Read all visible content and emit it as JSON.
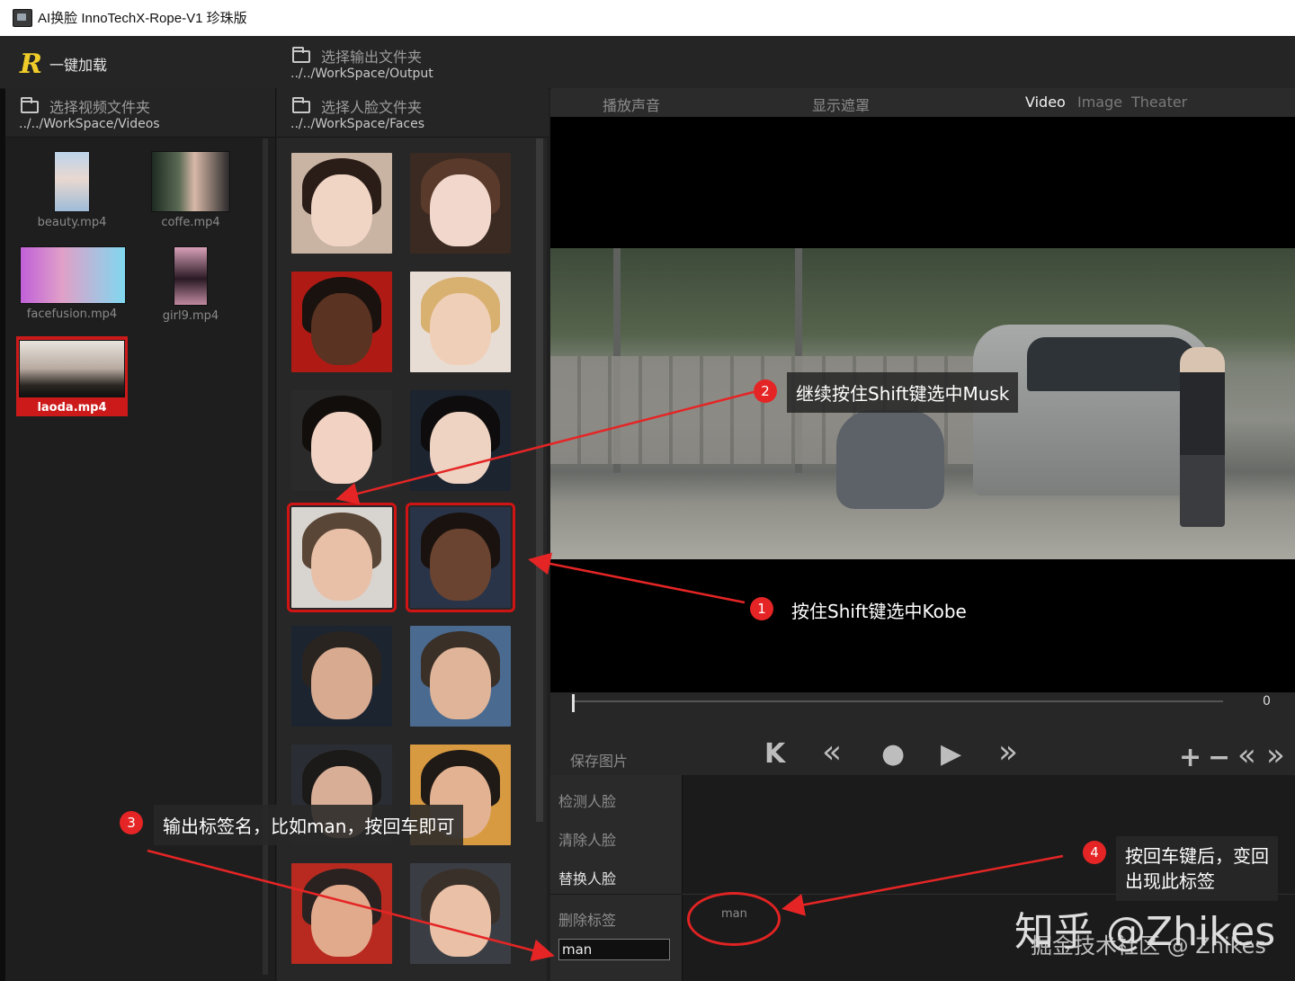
{
  "window": {
    "title": "AI换脸  InnoTechX-Rope-V1 珍珠版"
  },
  "header": {
    "logo": "R",
    "load_label": "一键加载",
    "output_dir_label": "选择输出文件夹",
    "output_dir_path": "../../WorkSpace/Output"
  },
  "videos": {
    "dir_label": "选择视频文件夹",
    "dir_path": "../../WorkSpace/Videos",
    "items": [
      {
        "name": "beauty.mp4"
      },
      {
        "name": "coffe.mp4"
      },
      {
        "name": "facefusion.mp4"
      },
      {
        "name": "girl9.mp4"
      },
      {
        "name": "laoda.mp4"
      }
    ],
    "selected": "laoda.mp4"
  },
  "faces": {
    "dir_label": "选择人脸文件夹",
    "dir_path": "../../WorkSpace/Faces",
    "selected_count": 2
  },
  "viewer": {
    "tabs": {
      "audio": "播放声音",
      "mask": "显示遮罩",
      "video": "Video",
      "image": "Image",
      "theater": "Theater"
    },
    "active_tab": "Video",
    "frame_number": "0",
    "save_image": "保存图片",
    "controls": {
      "first": "K",
      "rewind": "«",
      "record": "●",
      "play": "▶",
      "forward": "»",
      "add": "+",
      "remove": "−",
      "prev": "«",
      "next": "»"
    }
  },
  "actions": {
    "detect": "检测人脸",
    "clear": "清除人脸",
    "swap": "替换人脸",
    "delete_tag": "删除标签"
  },
  "tag_input": {
    "value": "man"
  },
  "tags": [
    "man"
  ],
  "annotations": {
    "step1": {
      "num": "1",
      "text": "按住Shift键选中Kobe"
    },
    "step2": {
      "num": "2",
      "text": "继续按住Shift键选中Musk"
    },
    "step3": {
      "num": "3",
      "text": "输出标签名，比如man，按回车即可"
    },
    "step4": {
      "num": "4",
      "line1": "按回车键后，变回",
      "line2": "出现此标签"
    }
  },
  "watermark": {
    "line1": "知乎 @Zhikes",
    "line2": "掘金技术社区 @ Zhikes"
  },
  "colors": {
    "accent_red": "#d01414",
    "logo_yellow": "#f0cc2a",
    "background": "#202020"
  }
}
